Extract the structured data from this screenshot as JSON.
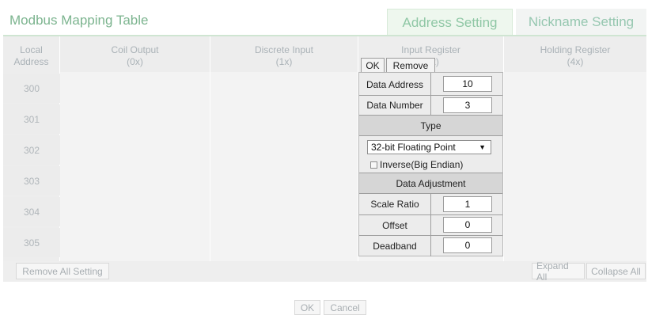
{
  "header": {
    "title": "Modbus Mapping Table",
    "tabs": [
      {
        "label": "Address Setting",
        "active": true
      },
      {
        "label": "Nickname Setting",
        "active": false
      }
    ]
  },
  "table": {
    "columns": [
      {
        "label": "Local\nAddress"
      },
      {
        "label": "Coil Output\n(0x)"
      },
      {
        "label": "Discrete Input\n(1x)"
      },
      {
        "label": "Input Register\n(3x)"
      },
      {
        "label": "Holding Register\n(4x)"
      }
    ],
    "rows": [
      "300",
      "301",
      "302",
      "303",
      "304",
      "305"
    ]
  },
  "popup": {
    "ok_label": "OK",
    "remove_label": "Remove",
    "data_address_label": "Data Address",
    "data_address_value": "10",
    "data_number_label": "Data Number",
    "data_number_value": "3",
    "type_section": "Type",
    "type_selected": "32-bit Floating Point",
    "inverse_label": "Inverse(Big Endian)",
    "inverse_checked": false,
    "adjust_section": "Data Adjustment",
    "scale_label": "Scale Ratio",
    "scale_value": "1",
    "offset_label": "Offset",
    "offset_value": "0",
    "deadband_label": "Deadband",
    "deadband_value": "0"
  },
  "toolbar": {
    "remove_all": "Remove All Setting",
    "expand_all": "Expand All",
    "collapse_all": "Collapse All"
  },
  "footer": {
    "ok": "OK",
    "cancel": "Cancel"
  },
  "colors": {
    "accent_green": "#7cb48f",
    "panel_gray": "#ededed"
  }
}
